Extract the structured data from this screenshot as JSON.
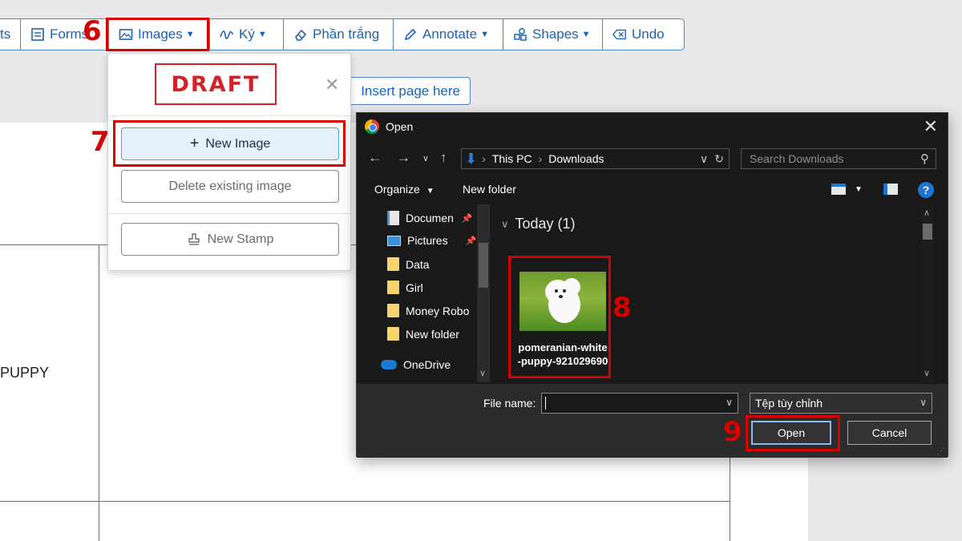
{
  "toolbar": {
    "items": [
      {
        "label": "ts",
        "icon": "text-icon"
      },
      {
        "label": "Forms",
        "icon": "form-icon"
      },
      {
        "label": "Images",
        "icon": "image-icon"
      },
      {
        "label": "Ký",
        "icon": "signature-icon"
      },
      {
        "label": "Phần trắng",
        "icon": "eraser-icon"
      },
      {
        "label": "Annotate",
        "icon": "pen-icon"
      },
      {
        "label": "Shapes",
        "icon": "shapes-icon"
      },
      {
        "label": "Undo",
        "icon": "undo-icon"
      }
    ]
  },
  "page": {
    "insert_page_label": "Insert page here",
    "cell_text": "PUPPY"
  },
  "dropdown": {
    "stamp_text": "DRAFT",
    "new_image_label": "New Image",
    "delete_image_label": "Delete existing image",
    "new_stamp_label": "New Stamp"
  },
  "dialog": {
    "title": "Open",
    "path": [
      "This PC",
      "Downloads"
    ],
    "search_placeholder": "Search Downloads",
    "organize_label": "Organize",
    "new_folder_label": "New folder",
    "nav_items": [
      {
        "label": "Documen",
        "icon": "document-folder-icon",
        "pinned": true
      },
      {
        "label": "Pictures",
        "icon": "pictures-folder-icon",
        "pinned": true
      },
      {
        "label": "Data",
        "icon": "folder-icon",
        "pinned": false
      },
      {
        "label": "Girl",
        "icon": "folder-icon",
        "pinned": false
      },
      {
        "label": "Money Robo",
        "icon": "folder-icon",
        "pinned": false
      },
      {
        "label": "New folder",
        "icon": "folder-icon",
        "pinned": false
      },
      {
        "label": "OneDrive",
        "icon": "onedrive-cloud-icon",
        "pinned": false
      }
    ],
    "group_header": "Today (1)",
    "file": {
      "name": "pomeranian-white-puppy-921029690"
    },
    "file_name_label": "File name:",
    "file_name_value": "",
    "file_type": "Tệp tùy chỉnh",
    "open_label": "Open",
    "cancel_label": "Cancel"
  },
  "callouts": {
    "step6": "6",
    "step7": "7",
    "step8": "8",
    "step9": "9"
  },
  "colors": {
    "accent": "#1b63b4",
    "highlight": "#d50000",
    "dialog_bg": "#191919",
    "draft_red": "#d62027"
  }
}
